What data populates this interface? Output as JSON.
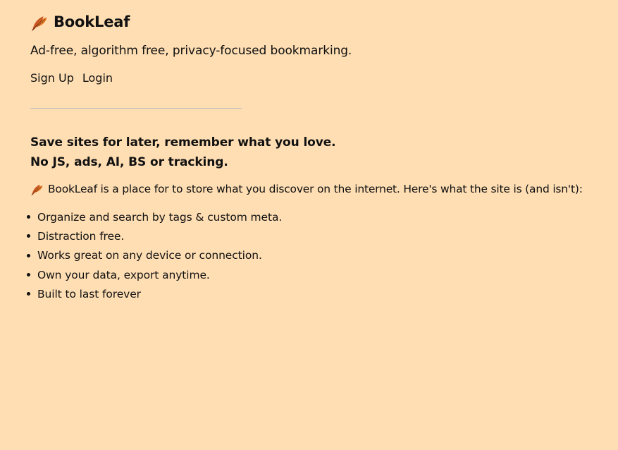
{
  "header": {
    "brand_icon": "fallen-leaf-icon",
    "brand_name": "BookLeaf",
    "tagline": "Ad-free, algorithm free, privacy-focused bookmarking."
  },
  "auth_nav": {
    "sign_up_label": "Sign Up",
    "login_label": "Login"
  },
  "main": {
    "headline_line1": "Save sites for later, remember what you love.",
    "headline_line2": "No JS, ads, AI, BS or tracking.",
    "intro_icon": "fallen-leaf-icon",
    "intro_text": "BookLeaf is a place for to store what you discover on the internet. Here's what the site is (and isn't):",
    "features": [
      "Organize and search by tags & custom meta.",
      "Distraction free.",
      "Works great on any device or connection.",
      "Own your data, export anytime.",
      "Built to last forever"
    ]
  },
  "colors": {
    "background": "#ffdeb3",
    "text": "#111111",
    "divider": "#bdbdbd"
  }
}
